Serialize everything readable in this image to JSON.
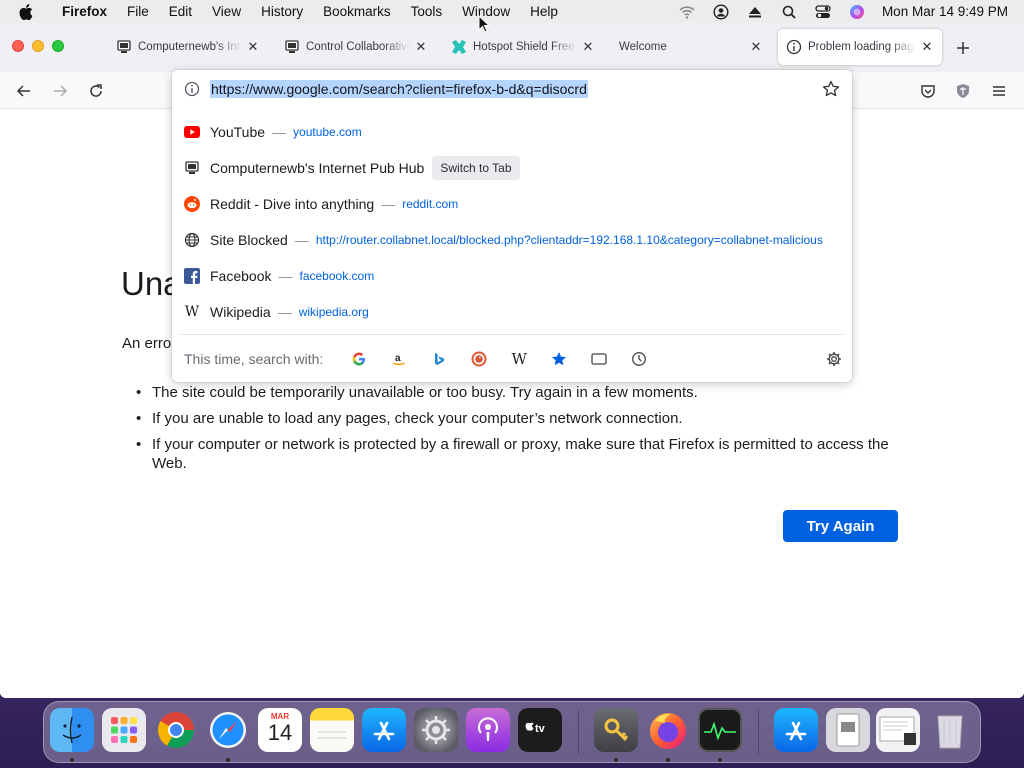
{
  "menubar": {
    "app_name": "Firefox",
    "items": [
      "File",
      "Edit",
      "View",
      "History",
      "Bookmarks",
      "Tools",
      "Window",
      "Help"
    ],
    "clock": "Mon Mar 14  9:49 PM"
  },
  "tabs": [
    {
      "title": "Computernewb's Internet Pub Hub",
      "icon": "computernewb-icon"
    },
    {
      "title": "Control Collaborative",
      "icon": "computernewb-icon"
    },
    {
      "title": "Hotspot Shield Free VPN",
      "icon": "hotspot-shield-icon"
    },
    {
      "title": "Welcome",
      "icon": ""
    },
    {
      "title": "Problem loading page",
      "icon": "info-icon"
    }
  ],
  "urlbar": {
    "value": "https://www.google.com/search?client=firefox-b-d&q=disocrd"
  },
  "results": [
    {
      "title": "YouTube",
      "url": "youtube.com",
      "icon": "youtube-icon"
    },
    {
      "title": "Computernewb's Internet Pub Hub",
      "action": "Switch to Tab",
      "icon": "computernewb-icon"
    },
    {
      "title": "Reddit - Dive into anything",
      "url": "reddit.com",
      "icon": "reddit-icon"
    },
    {
      "title": "Site Blocked",
      "url": "http://router.collabnet.local/blocked.php?clientaddr=192.168.1.10&category=collabnet-malicious",
      "icon": "globe-icon"
    },
    {
      "title": "Facebook",
      "url": "facebook.com",
      "icon": "facebook-icon"
    },
    {
      "title": "Wikipedia",
      "url": "wikipedia.org",
      "icon": "wikipedia-icon"
    }
  ],
  "separator": "—",
  "onesearch": {
    "label": "This time, search with:",
    "engines": [
      "google-icon",
      "amazon-icon",
      "bing-icon",
      "duckduckgo-icon",
      "wikipedia-icon",
      "bookmarks-icon",
      "tabs-icon",
      "history-icon"
    ]
  },
  "page": {
    "title_visible": "Una",
    "intro_visible": "An erro",
    "bullets": [
      "The site could be temporarily unavailable or too busy. Try again in a few moments.",
      "If you are unable to load any pages, check your computer’s network connection.",
      "If your computer or network is protected by a firewall or proxy, make sure that Firefox is permitted to access the Web."
    ],
    "try_again": "Try Again"
  },
  "colors": {
    "accent": "#0061e0",
    "url_selection": "#b4d5fe",
    "link": "#0061e0"
  },
  "dock": {
    "apps": [
      "finder-icon",
      "launchpad-icon",
      "chrome-icon",
      "safari-icon",
      "calendar-icon",
      "notes-icon",
      "app-store-icon",
      "system-preferences-icon",
      "podcasts-icon",
      "apple-tv-icon",
      "keychain-icon",
      "firefox-icon",
      "activity-monitor-icon",
      "app-store-download-icon",
      "file-icon",
      "screenshot-icon",
      "trash-icon"
    ],
    "calendar_month": "MAR",
    "calendar_day": "14"
  }
}
